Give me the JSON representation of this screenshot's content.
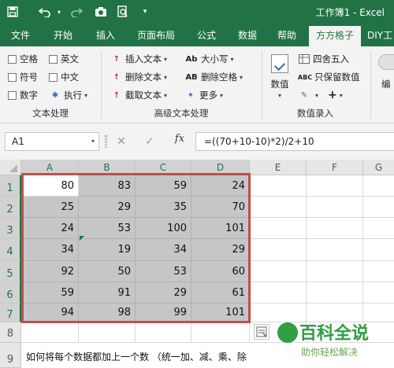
{
  "titlebar": {
    "doc_title": "工作簿1 - Excel",
    "qa_icons": [
      "save-icon",
      "undo-icon",
      "redo-icon",
      "screen-capture-icon",
      "print-preview-icon",
      "customize-icon"
    ]
  },
  "tabs": [
    "文件",
    "开始",
    "插入",
    "页面布局",
    "公式",
    "数据",
    "帮助",
    "方方格子",
    "DIY工"
  ],
  "active_tab": "方方格子",
  "ribbon": {
    "text_group": {
      "items": [
        "空格",
        "英文",
        "符号",
        "中文",
        "数字",
        "执行"
      ],
      "label": "文本处理"
    },
    "advanced_group": {
      "items": [
        "插入文本",
        "删除文本",
        "截取文本",
        "大小写",
        "删除空格",
        "更多"
      ],
      "icon_text": [
        "Ab",
        "AB"
      ],
      "label": "高级文本处理"
    },
    "data_group": {
      "big_button": "数值",
      "items": [
        "四舍五入",
        "只保留数值"
      ],
      "icon_text": "ABC",
      "plus": "+",
      "label": "数值录入"
    },
    "edit_label": "编"
  },
  "formula_bar": {
    "name_box": "A1",
    "fx": "fx",
    "formula": "=((70+10-10)*2)/2+10"
  },
  "grid": {
    "columns": [
      "A",
      "B",
      "C",
      "D",
      "E",
      "F",
      "G"
    ],
    "rows": [
      "1",
      "2",
      "3",
      "4",
      "5",
      "6",
      "7",
      "8",
      "9"
    ],
    "values": [
      [
        "80",
        "83",
        "59",
        "24"
      ],
      [
        "25",
        "29",
        "35",
        "70"
      ],
      [
        "24",
        "53",
        "100",
        "101"
      ],
      [
        "34",
        "19",
        "34",
        "29"
      ],
      [
        "92",
        "50",
        "53",
        "60"
      ],
      [
        "59",
        "91",
        "29",
        "61"
      ],
      [
        "94",
        "98",
        "99",
        "101"
      ]
    ],
    "row9_text": "如何将每个数据都加上一个数 （统一加、减、乘、除"
  },
  "watermark": {
    "main": "百科全说",
    "sub": "助你轻松解决"
  },
  "colors": {
    "excel_green": "#217346",
    "selection_border": "#c0504d",
    "cell_highlight": "#c6c6c6"
  }
}
